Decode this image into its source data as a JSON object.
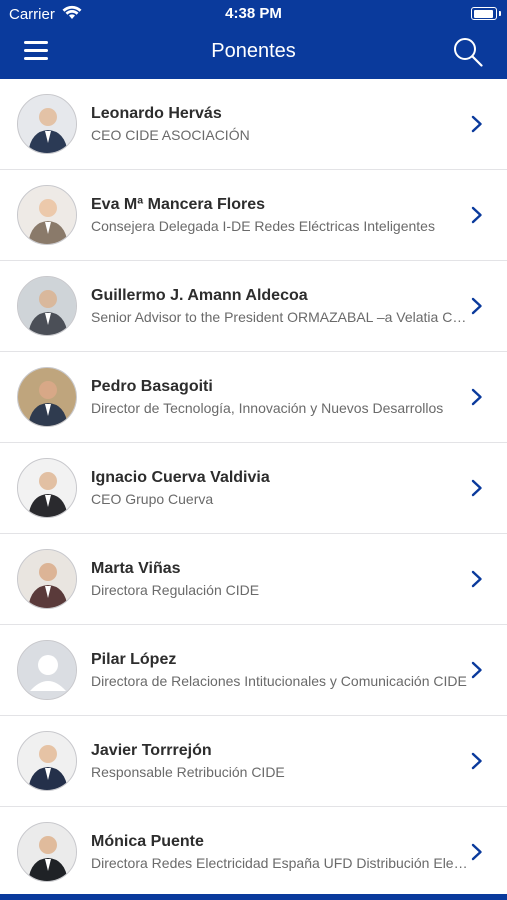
{
  "status_bar": {
    "carrier": "Carrier",
    "time": "4:38 PM"
  },
  "nav": {
    "title": "Ponentes"
  },
  "colors": {
    "brand": "#0a3a9c",
    "chevron": "#0a3a9c",
    "name_text": "#2d2d2d",
    "role_text": "#6a6a6a"
  },
  "speakers": [
    {
      "name": "Leonardo Hervás",
      "role": "CEO CIDE ASOCIACIÓN"
    },
    {
      "name": "Eva Mª Mancera Flores",
      "role": "Consejera Delegada I-DE Redes Eléctricas Inteligentes"
    },
    {
      "name": "Guillermo J. Amann Aldecoa",
      "role": "Senior Advisor to the President ORMAZABAL –a Velatia C…"
    },
    {
      "name": "Pedro Basagoiti",
      "role": "Director de Tecnología, Innovación y Nuevos Desarrollos"
    },
    {
      "name": "Ignacio Cuerva Valdivia",
      "role": "CEO Grupo Cuerva"
    },
    {
      "name": "Marta Viñas",
      "role": "Directora Regulación CIDE"
    },
    {
      "name": "Pilar López",
      "role": "Directora de Relaciones Intitucionales y Comunicación CIDE"
    },
    {
      "name": "Javier Torrrejón",
      "role": "Responsable Retribución CIDE"
    },
    {
      "name": "Mónica Puente",
      "role": "Directora Redes Electricidad España UFD Distribución Ele…"
    }
  ]
}
